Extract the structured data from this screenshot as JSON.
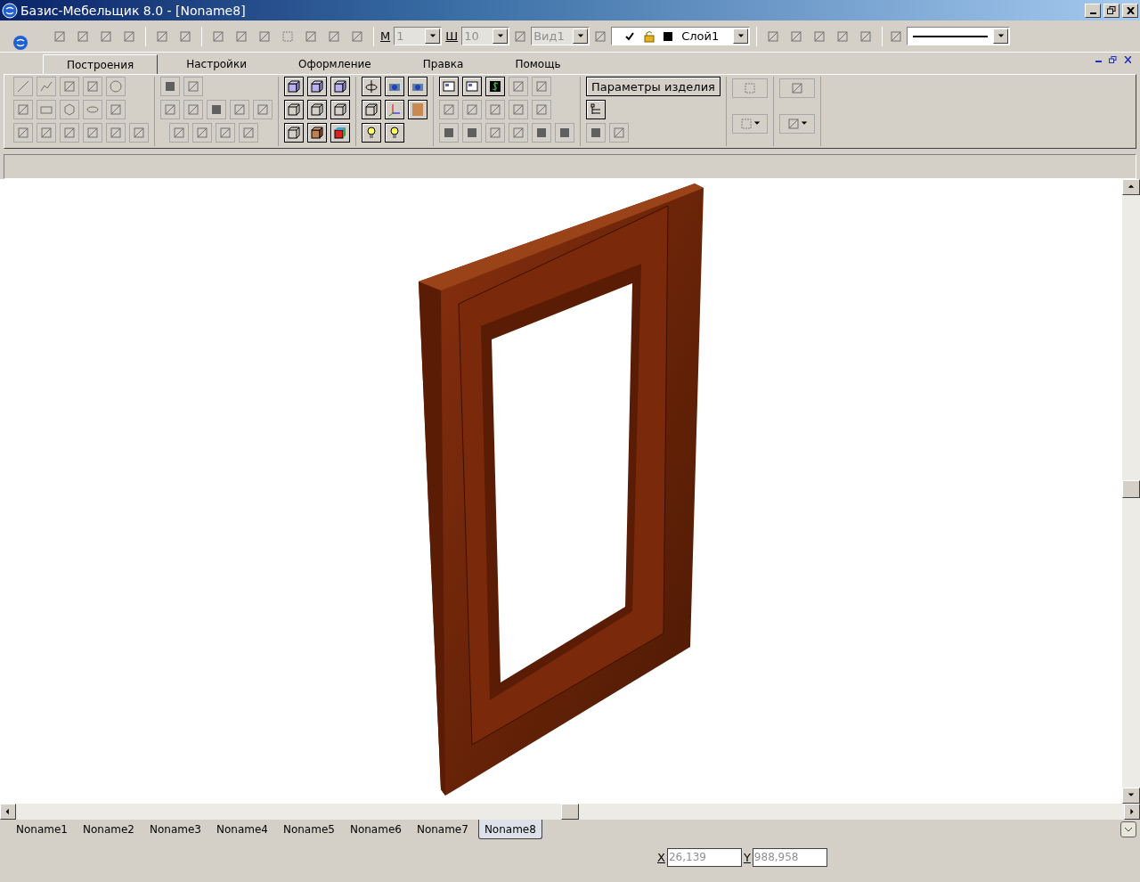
{
  "window": {
    "title": "Базис-Мебельщик 8.0 - [Noname8]"
  },
  "toolbar": {
    "m_label": "М",
    "m_value": "1",
    "w_label": "Ш",
    "w_value": "10",
    "view": "Вид1",
    "layer": {
      "visible": true,
      "name": "Слой1"
    }
  },
  "ribbon_tabs": [
    {
      "label": "Построения",
      "selected": true
    },
    {
      "label": "Настройки",
      "selected": false
    },
    {
      "label": "Оформление",
      "selected": false
    },
    {
      "label": "Правка",
      "selected": false
    },
    {
      "label": "Помощь",
      "selected": false
    }
  ],
  "ribbon": {
    "product_button": "Параметры изделия"
  },
  "document_tabs": [
    {
      "label": "Noname1",
      "selected": false
    },
    {
      "label": "Noname2",
      "selected": false
    },
    {
      "label": "Noname3",
      "selected": false
    },
    {
      "label": "Noname4",
      "selected": false
    },
    {
      "label": "Noname5",
      "selected": false
    },
    {
      "label": "Noname6",
      "selected": false
    },
    {
      "label": "Noname7",
      "selected": false
    },
    {
      "label": "Noname8",
      "selected": true
    }
  ],
  "status_bar": {
    "x_label": "X",
    "x_value": "26,139",
    "y_label": "Y",
    "y_value": "988,958"
  }
}
